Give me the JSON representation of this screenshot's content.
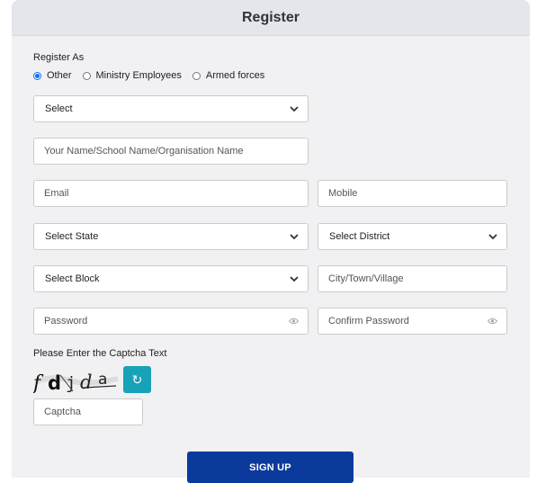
{
  "header": {
    "title": "Register"
  },
  "register_as": {
    "label": "Register As",
    "options": [
      "Other",
      "Ministry Employees",
      "Armed forces"
    ],
    "selected": "Other"
  },
  "form": {
    "category_select": "Select",
    "name_placeholder": "Your Name/School Name/Organisation Name",
    "email_placeholder": "Email",
    "mobile_placeholder": "Mobile",
    "state_select": "Select State",
    "district_select": "Select District",
    "block_select": "Select Block",
    "city_placeholder": "City/Town/Village",
    "password_placeholder": "Password",
    "confirm_password_placeholder": "Confirm Password"
  },
  "captcha": {
    "label": "Please Enter the Captcha Text",
    "image_text": "fdjda",
    "refresh_icon": "refresh-icon",
    "input_placeholder": "Captcha"
  },
  "actions": {
    "signup_label": "SIGN UP"
  },
  "colors": {
    "primary": "#0c3a9c",
    "refresh": "#17a2b8",
    "radio_checked": "#0d6efd",
    "panel": "#f1f1f3",
    "header": "#e4e6ec"
  }
}
